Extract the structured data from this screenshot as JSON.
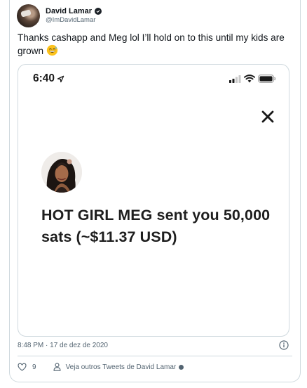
{
  "author": {
    "display_name": "David Lamar",
    "handle": "@ImDavidLamar"
  },
  "tweet": {
    "text": "Thanks cashapp and Meg lol I’ll hold on to this until my kids are grown",
    "emoji": "grinning-sweat-emoji"
  },
  "screenshot": {
    "status_time": "6:40",
    "notification": "HOT GIRL MEG sent you 50,000 sats (~$11.37 USD)"
  },
  "meta": {
    "timestamp": "8:48 PM · 17 de dez de 2020"
  },
  "footer": {
    "like_count": "9",
    "more_tweets": "Veja outros Tweets de David Lamar"
  },
  "colors": {
    "border": "#cfd9de",
    "secondary_text": "#536471",
    "primary_text": "#0f1419"
  }
}
